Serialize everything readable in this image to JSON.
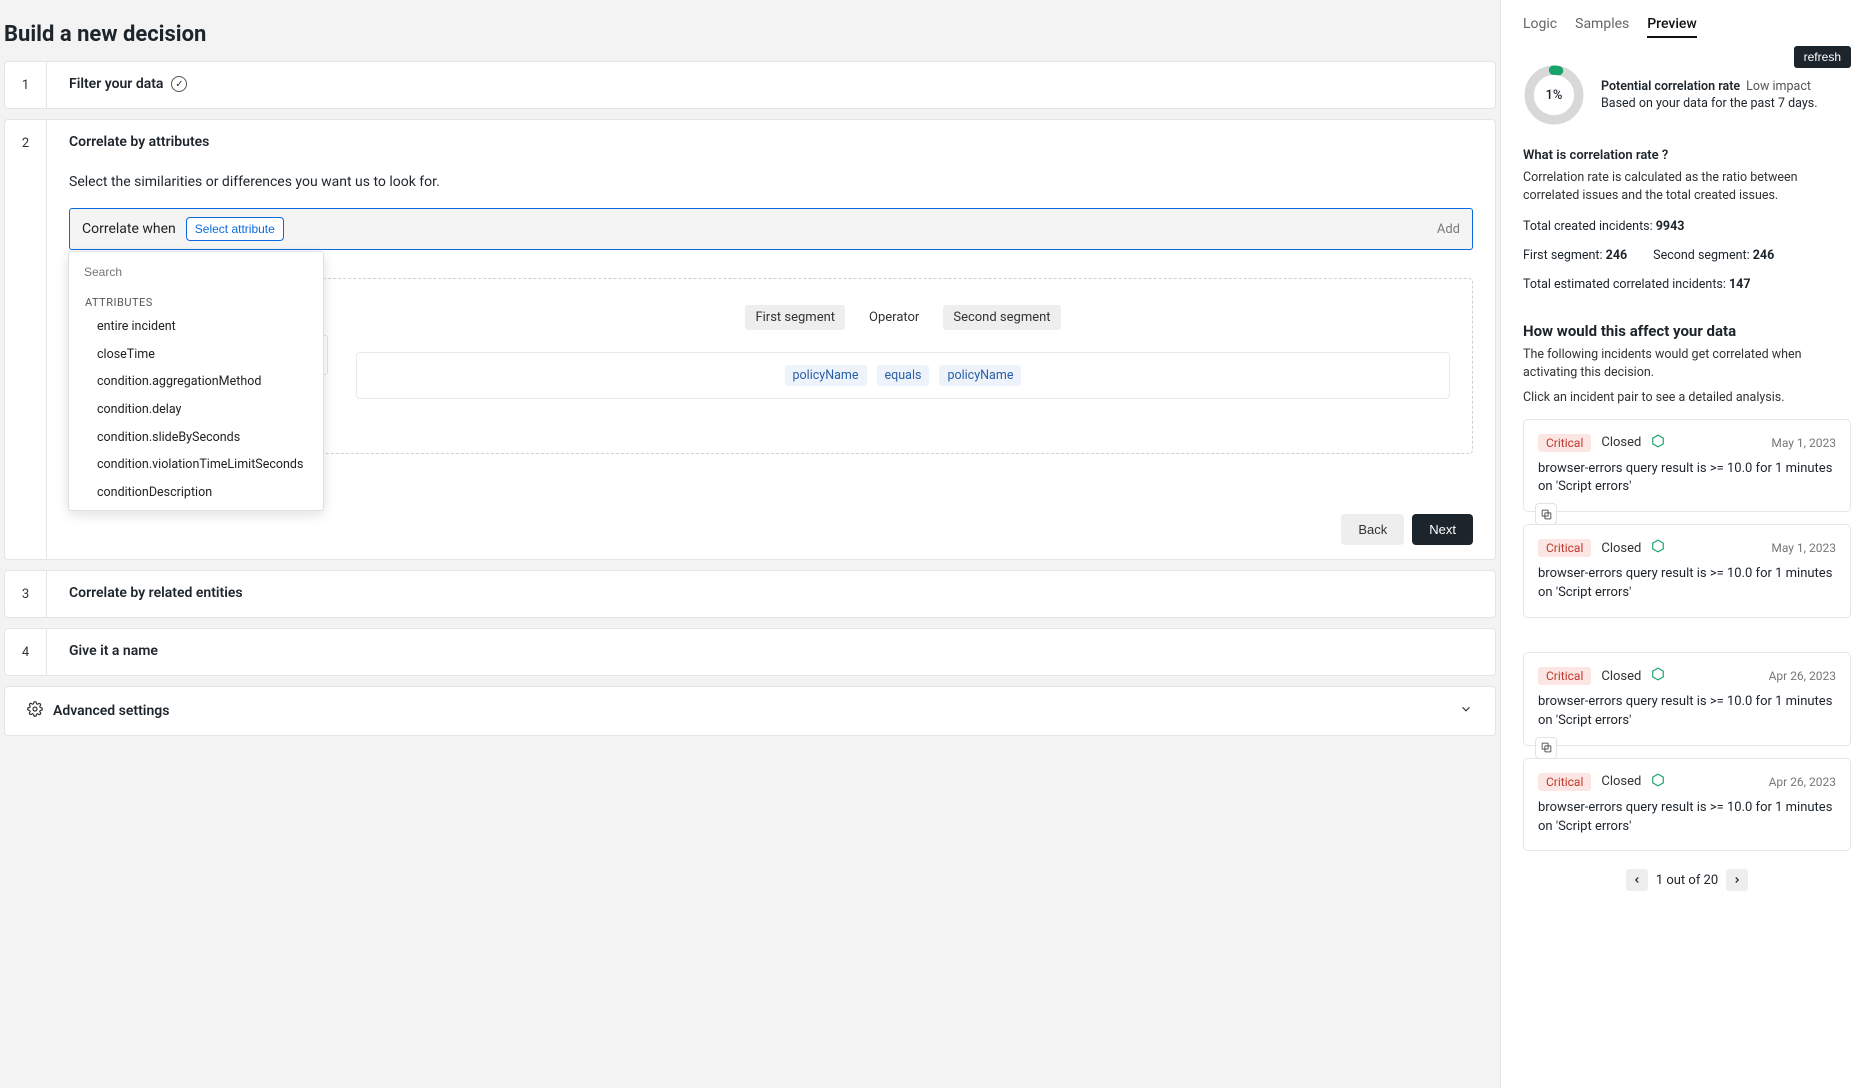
{
  "title": "Build a new decision",
  "steps": {
    "filter": {
      "num": "1",
      "title": "Filter your data"
    },
    "correlate": {
      "num": "2",
      "title": "Correlate by attributes",
      "desc": "Select the similarities or differences you want us to look for.",
      "correlate_label": "Correlate when",
      "select_attr": "Select attribute",
      "add": "Add",
      "back": "Back",
      "next": "Next",
      "table_headers": {
        "first": "First segment",
        "op": "Operator",
        "second": "Second segment"
      },
      "row": {
        "first": "policyName",
        "op": "equals",
        "second": "policyName"
      }
    },
    "entities": {
      "num": "3",
      "title": "Correlate by related entities"
    },
    "name": {
      "num": "4",
      "title": "Give it a name"
    },
    "advanced": {
      "title": "Advanced settings"
    }
  },
  "dropdown": {
    "search_placeholder": "Search",
    "group": "ATTRIBUTES",
    "items": [
      "entire incident",
      "closeTime",
      "condition.aggregationMethod",
      "condition.delay",
      "condition.slideBySeconds",
      "condition.violationTimeLimitSeconds",
      "conditionDescription"
    ]
  },
  "side": {
    "tabs": {
      "logic": "Logic",
      "samples": "Samples",
      "preview": "Preview"
    },
    "refresh": "refresh",
    "gauge_pct": "1%",
    "gauge_title": "Potential correlation rate",
    "gauge_impact": "Low impact",
    "gauge_sub": "Based on your data for the past 7 days.",
    "rate_q": "What is correlation rate ?",
    "rate_a": "Correlation rate is calculated as the ratio between correlated issues and the total created issues.",
    "total_created_label": "Total created incidents:",
    "total_created_val": "9943",
    "first_seg_label": "First segment:",
    "first_seg_val": "246",
    "second_seg_label": "Second segment:",
    "second_seg_val": "246",
    "est_label": "Total estimated correlated incidents:",
    "est_val": "147",
    "affect_h": "How would this affect your data",
    "affect_p1": "The following incidents would get correlated when activating this decision.",
    "affect_p2": "Click an incident pair to see a detailed analysis.",
    "incidents": [
      {
        "badge": "Critical",
        "state": "Closed",
        "date": "May 1, 2023",
        "msg": "browser-errors query result is >= 10.0 for 1 minutes on 'Script errors'"
      },
      {
        "badge": "Critical",
        "state": "Closed",
        "date": "May 1, 2023",
        "msg": "browser-errors query result is >= 10.0 for 1 minutes on 'Script errors'"
      },
      {
        "badge": "Critical",
        "state": "Closed",
        "date": "Apr 26, 2023",
        "msg": "browser-errors query result is >= 10.0 for 1 minutes on 'Script errors'"
      },
      {
        "badge": "Critical",
        "state": "Closed",
        "date": "Apr 26, 2023",
        "msg": "browser-errors query result is >= 10.0 for 1 minutes on 'Script errors'"
      }
    ],
    "pager": "1 out of 20"
  }
}
